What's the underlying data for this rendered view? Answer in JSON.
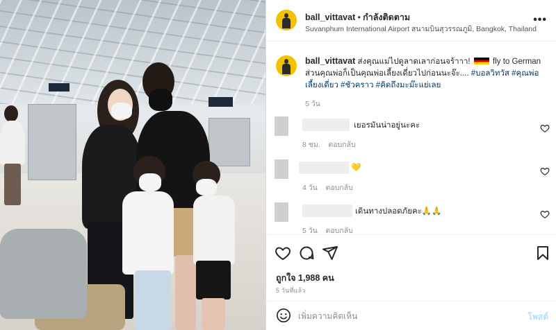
{
  "post": {
    "username": "ball_vittavat",
    "separator": "•",
    "follow_label": "กำลังติดตาม",
    "location": "Suvanphum International Airport สนามบินสุวรรณภูมิ, Bangkok, Thailand",
    "more_icon": "more-horizontal-icon"
  },
  "caption": {
    "username": "ball_vittavat",
    "text_part1": "ส่งคุณแม่ไปดูลาดเลาก่อนจร้าาา!",
    "flag": "🇩🇪",
    "text_part2": "fly to German",
    "text_line2": "ส่วนคุณพ่อก็เป็นคุณพ่อเลี้ยงเดี่ยวไปก่อนนะจ๊ะ....",
    "tags": [
      "#บอลวิทวัส",
      "#คุณพ่อเลี้ยงเดี่ยว",
      "#ชัวคราว",
      "#คิดถึงมะม๊ะแย่เลย"
    ],
    "age": "5 วัน"
  },
  "comments": [
    {
      "text": "เยอรมันน่าอยู่นะคะ",
      "age": "8 ชม.",
      "reply": "ตอบกลับ"
    },
    {
      "text": "💛",
      "age": "4 วัน",
      "reply": "ตอบกลับ"
    },
    {
      "text": "เดินทางปลอดภัยคะ🙏🙏",
      "age": "5 วัน",
      "reply": "ตอบกลับ"
    }
  ],
  "actions": {
    "icons": [
      "heart-icon",
      "comment-icon",
      "share-icon",
      "bookmark-icon"
    ],
    "likes": "ถูกใจ 1,988 คน",
    "posted": "5 วันที่แล้ว"
  },
  "add_comment": {
    "placeholder": "เพิ่มความคิดเห็น",
    "post_label": "โพสต์"
  },
  "colors": {
    "link": "#00376b",
    "muted": "#8e8e8e",
    "post_button": "#b2dffc",
    "avatar_bg": "#f2c200"
  }
}
